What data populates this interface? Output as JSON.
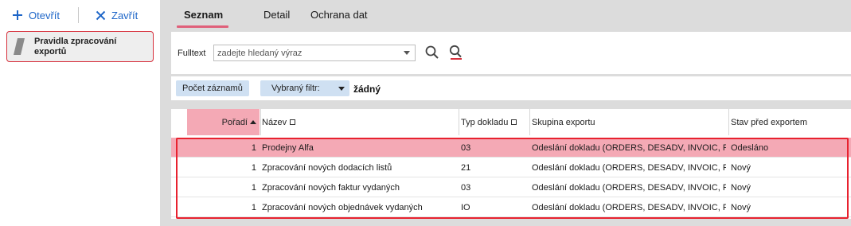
{
  "sidebar": {
    "open_label": "Otevřít",
    "close_label": "Zavřít",
    "item_label": "Pravidla zpracování exportů"
  },
  "tabs": [
    {
      "label": "Seznam",
      "active": true
    },
    {
      "label": "Detail",
      "active": false
    },
    {
      "label": "Ochrana dat",
      "active": false
    }
  ],
  "search": {
    "label": "Fulltext",
    "placeholder": "zadejte hledaný výraz"
  },
  "filter": {
    "count_button": "Počet záznamů",
    "filter_button": "Vybraný filtr:",
    "filter_value": "žádný"
  },
  "grid": {
    "columns": [
      "Pořadí",
      "Název",
      "Typ dokladu",
      "Skupina exportu",
      "Stav před exportem"
    ],
    "rows": [
      {
        "poradi": "1",
        "nazev": "Prodejny Alfa",
        "typ": "03",
        "skupina": "Odeslání dokladu (ORDERS, DESADV, INVOIC, RE",
        "stav": "Odesláno",
        "selected": true
      },
      {
        "poradi": "1",
        "nazev": "Zpracování nových dodacích listů",
        "typ": "21",
        "skupina": "Odeslání dokladu (ORDERS, DESADV, INVOIC, RE",
        "stav": "Nový",
        "selected": false
      },
      {
        "poradi": "1",
        "nazev": "Zpracování nových faktur vydaných",
        "typ": "03",
        "skupina": "Odeslání dokladu (ORDERS, DESADV, INVOIC, RE",
        "stav": "Nový",
        "selected": false
      },
      {
        "poradi": "1",
        "nazev": "Zpracování nových objednávek vydaných",
        "typ": "IO",
        "skupina": "Odeslání dokladu (ORDERS, DESADV, INVOIC, RE",
        "stav": "Nový",
        "selected": false
      }
    ]
  },
  "colors": {
    "accent_blue": "#1e66c8",
    "selection_pink": "#f4a9b5",
    "highlight_red": "#e8222f",
    "tab_underline": "#e0607a"
  }
}
